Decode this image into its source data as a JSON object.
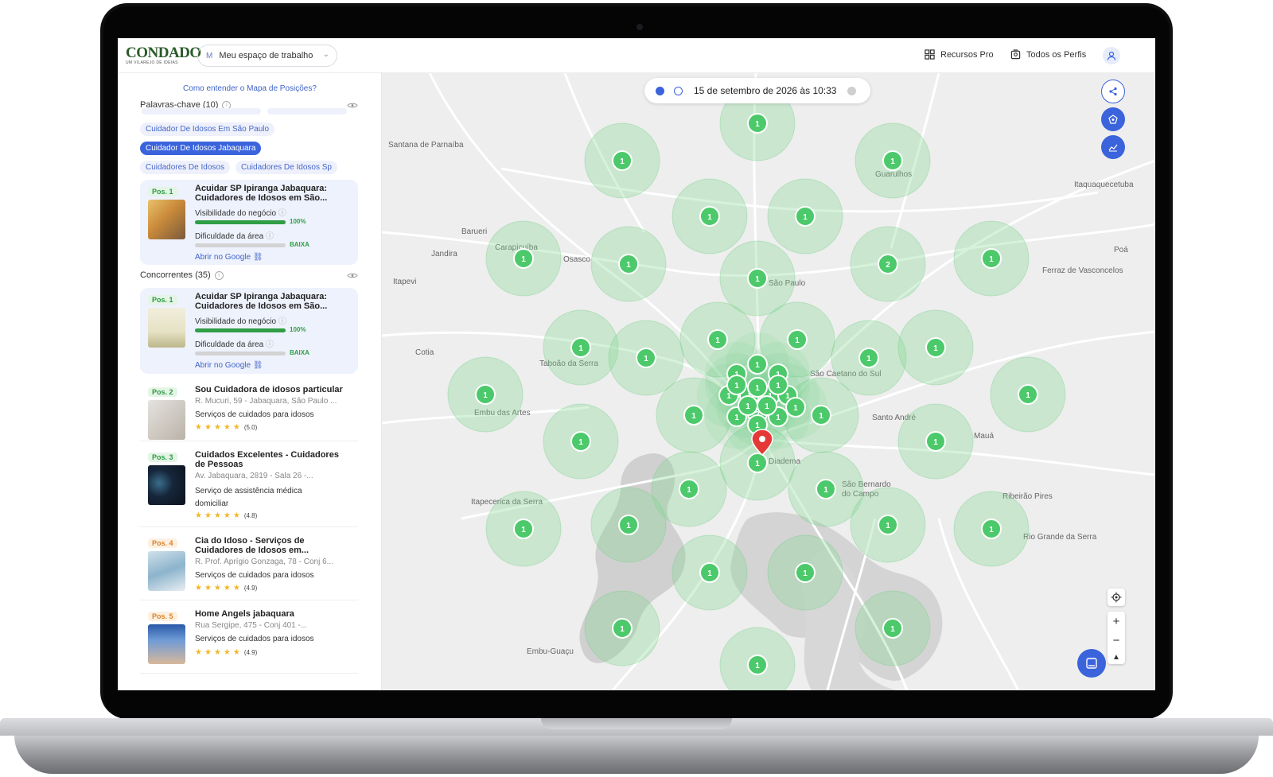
{
  "header": {
    "logo_text": "CONDADO",
    "logo_tagline": "UM VILAREJO DE IDEIAS",
    "workspace_initial": "M",
    "workspace_label": "Meu espaço de trabalho",
    "pro_label": "Recursos Pro",
    "profiles_label": "Todos os Perfis"
  },
  "sidebar": {
    "help_link": "Como entender o Mapa de Posições?",
    "keywords_header": "Palavras-chave (10)",
    "chips": [
      "Cuidador De Idosos Em São Paulo",
      "Cuidador De Idosos Jabaquara",
      "Cuidadores De Idosos",
      "Cuidadores De Idosos Sp"
    ],
    "selected_business": {
      "pos": "Pos. 1",
      "title": "Acuidar SP Ipiranga Jabaquara: Cuidadores de Idosos em São...",
      "visibility_label": "Visibilidade do negócio",
      "visibility_value": "100%",
      "visibility_fraction": 1.0,
      "difficulty_label": "Dificuldade da área",
      "difficulty_value": "BAIXA",
      "difficulty_fraction": 0.0,
      "google_link": "Abrir no Google"
    },
    "competitors_header": "Concorrentes (35)",
    "top_competitor": {
      "pos": "Pos. 1",
      "title": "Acuidar SP Ipiranga Jabaquara: Cuidadores de Idosos em São...",
      "visibility_label": "Visibilidade do negócio",
      "visibility_value": "100%",
      "visibility_fraction": 1.0,
      "difficulty_label": "Dificuldade da área",
      "difficulty_value": "BAIXA",
      "difficulty_fraction": 0.0,
      "google_link": "Abrir no Google"
    },
    "competitors": [
      {
        "pos": "Pos. 2",
        "title": "Sou Cuidadora de idosos particular",
        "address": "R. Mucuri, 59 - Jabaquara, São Paulo ...",
        "category": "Serviços de cuidados para idosos",
        "rating": "(5.0)"
      },
      {
        "pos": "Pos. 3",
        "title": "Cuidados Excelentes - Cuidadores de Pessoas",
        "address": "Av. Jabaquara, 2819 - Sala 26 -...",
        "category": "Serviço de assistência médica domiciliar",
        "rating": "(4.8)"
      },
      {
        "pos": "Pos. 4",
        "title": "Cia do Idoso - Serviços de Cuidadores de Idosos em...",
        "address": "R. Prof. Aprígio Gonzaga, 78 - Conj 6...",
        "category": "Serviços de cuidados para idosos",
        "rating": "(4.9)"
      },
      {
        "pos": "Pos. 5",
        "title": "Home Angels jabaquara",
        "address": "Rua Sergipe, 475 - Conj 401 -...",
        "category": "Serviços de cuidados para idosos",
        "rating": "(4.9)"
      }
    ]
  },
  "map": {
    "date_label": "15 de setembro de 2026 às 10:33",
    "city_labels": [
      "Santana de Parnaíba",
      "Guarulhos",
      "Itaquaquecetuba",
      "Barueri",
      "Jandira",
      "Carapicuíba",
      "Osasco",
      "São Paulo",
      "Poá",
      "Ferraz de Vasconcelos",
      "Itapevi",
      "Cotia",
      "Taboão da Serra",
      "São Caetano do Sul",
      "Embu das Artes",
      "Santo André",
      "Mauá",
      "Diadema",
      "Itapecerica da Serra",
      "São Bernardo do Campo",
      "Ribeirão Pires",
      "Rio Grande da Serra",
      "Embu-Guaçu"
    ],
    "marker_rank_values": [
      1,
      1,
      1,
      1,
      1,
      1,
      1,
      1,
      2,
      1,
      1,
      1,
      1,
      1,
      1,
      1,
      1,
      1,
      1,
      1,
      1,
      1,
      1,
      1,
      1,
      1,
      1,
      1,
      1,
      1,
      1,
      1,
      1,
      1,
      1,
      1,
      1,
      1,
      1,
      1,
      1,
      1,
      2,
      1,
      1,
      1,
      1,
      1,
      1,
      1,
      1
    ],
    "controls": {
      "zoom_in": "+",
      "zoom_out": "−"
    }
  },
  "colors": {
    "accent": "#3a63dc",
    "rank_green": "#4cc96a",
    "success": "#2f9e46"
  }
}
